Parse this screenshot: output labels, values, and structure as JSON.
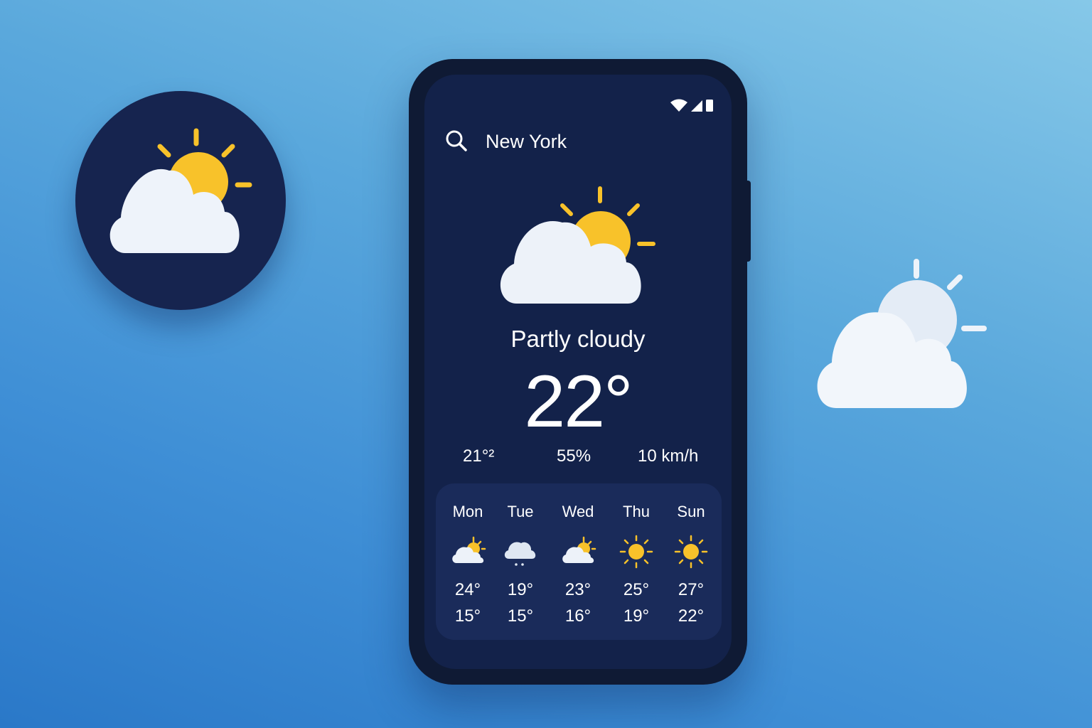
{
  "location": {
    "city": "New York"
  },
  "current": {
    "condition": "Partly cloudy",
    "temperature": "22°",
    "stat_1": "21°²",
    "stat_2": "55%",
    "stat_3": "10 km/h",
    "icon": "partly-cloudy-icon"
  },
  "forecast": [
    {
      "day": "Mon",
      "high": "24°",
      "low": "15°",
      "icon": "partly-cloudy-icon"
    },
    {
      "day": "Tue",
      "high": "19°",
      "low": "15°",
      "icon": "rain-cloud-icon"
    },
    {
      "day": "Wed",
      "high": "23°",
      "low": "16°",
      "icon": "partly-cloudy-icon"
    },
    {
      "day": "Thu",
      "high": "25°",
      "low": "19°",
      "icon": "sun-icon"
    },
    {
      "day": "Sun",
      "high": "27°",
      "low": "22°",
      "icon": "sun-icon"
    }
  ],
  "colors": {
    "background_light": "#86c8e8",
    "background_dark": "#2a78c8",
    "phone_body": "#0f1a34",
    "screen": "#13224a",
    "card": "#1a2b5a",
    "sun": "#f8c22a",
    "cloud": "#f2f6fb"
  },
  "status_icons": [
    "wifi-icon",
    "signal-icon",
    "battery-icon"
  ],
  "decor_icons": [
    "app-icon-partly-cloudy",
    "cloud-sun-outline-icon"
  ]
}
